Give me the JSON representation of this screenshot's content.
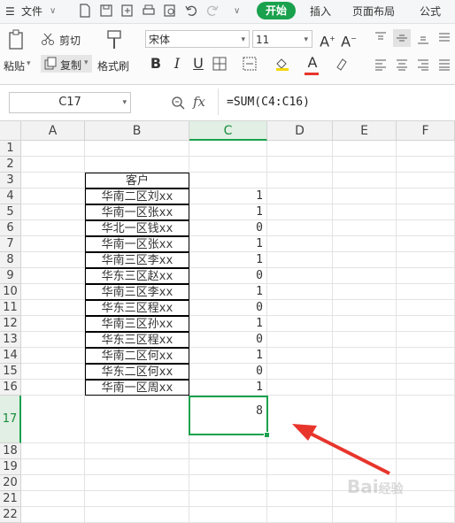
{
  "menubar": {
    "file_label": "文件",
    "tabs": [
      "开始",
      "插入",
      "页面布局",
      "公式"
    ]
  },
  "ribbon": {
    "paste_label": "粘贴",
    "cut_label": "剪切",
    "copy_label": "复制",
    "format_painter_label": "格式刷",
    "font_name": "宋体",
    "font_size": "11"
  },
  "formula_bar": {
    "name_box": "C17",
    "fx_label": "fx",
    "formula": "=SUM(C4:C16)"
  },
  "sheet": {
    "columns": [
      "A",
      "B",
      "C",
      "D",
      "E",
      "F"
    ],
    "rows": [
      "1",
      "2",
      "3",
      "4",
      "5",
      "6",
      "7",
      "8",
      "9",
      "10",
      "11",
      "12",
      "13",
      "14",
      "15",
      "16",
      "17",
      "18",
      "19",
      "20",
      "21",
      "22"
    ],
    "selected_cell": "C17",
    "header_b3": "客户",
    "customers": [
      "华南二区刘xx",
      "华南一区张xx",
      "华北一区钱xx",
      "华南一区张xx",
      "华南三区李xx",
      "华东三区赵xx",
      "华南三区李xx",
      "华东三区程xx",
      "华南三区孙xx",
      "华东三区程xx",
      "华南二区何xx",
      "华东二区何xx",
      "华南一区周xx"
    ],
    "values": [
      "1",
      "1",
      "0",
      "1",
      "1",
      "0",
      "1",
      "0",
      "1",
      "0",
      "1",
      "0",
      "1"
    ],
    "total": "8"
  },
  "colors": {
    "accent": "#1aa14d",
    "arrow": "#e8352c"
  },
  "watermark": "Bai 经验"
}
